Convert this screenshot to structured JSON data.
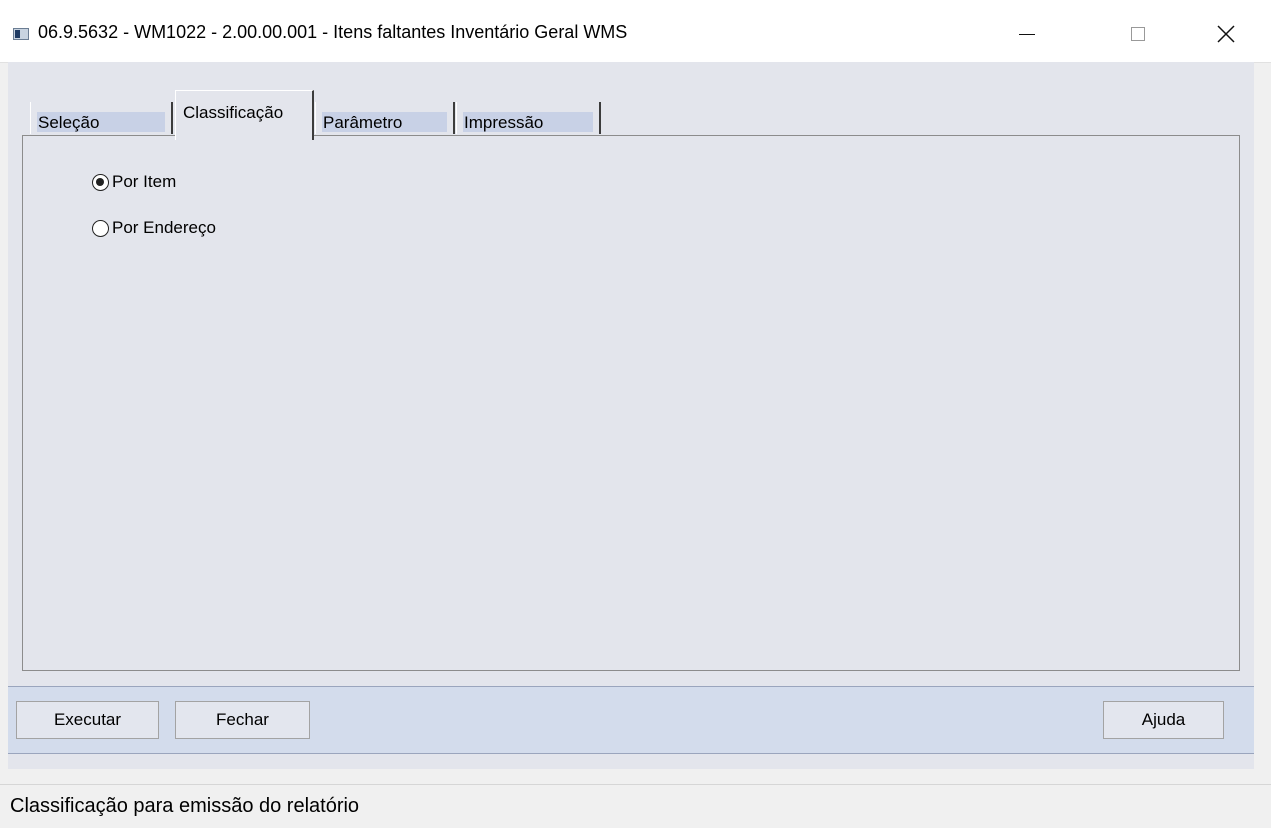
{
  "window": {
    "title": "06.9.5632 - WM1022 - 2.00.00.001 - Itens faltantes Inventário Geral WMS",
    "icon": "app-window-icon",
    "controls": [
      "minimize-icon",
      "maximize-icon",
      "close-icon"
    ]
  },
  "tabs": [
    {
      "label": "Seleção",
      "selected": false
    },
    {
      "label": "Classificação",
      "selected": true
    },
    {
      "label": "Parâmetro",
      "selected": false
    },
    {
      "label": "Impressão",
      "selected": false
    }
  ],
  "classification": {
    "options": [
      {
        "label": "Por Item",
        "checked": true
      },
      {
        "label": "Por Endereço",
        "checked": false
      }
    ]
  },
  "buttons": {
    "executar": "Executar",
    "fechar": "Fechar",
    "ajuda": "Ajuda"
  },
  "status": {
    "text": "Classificação para emissão do relatório"
  },
  "colors": {
    "client_background": "#e3e5ec",
    "tab_highlight": "#c8d1e6",
    "button_bar": "#d3dcec"
  }
}
